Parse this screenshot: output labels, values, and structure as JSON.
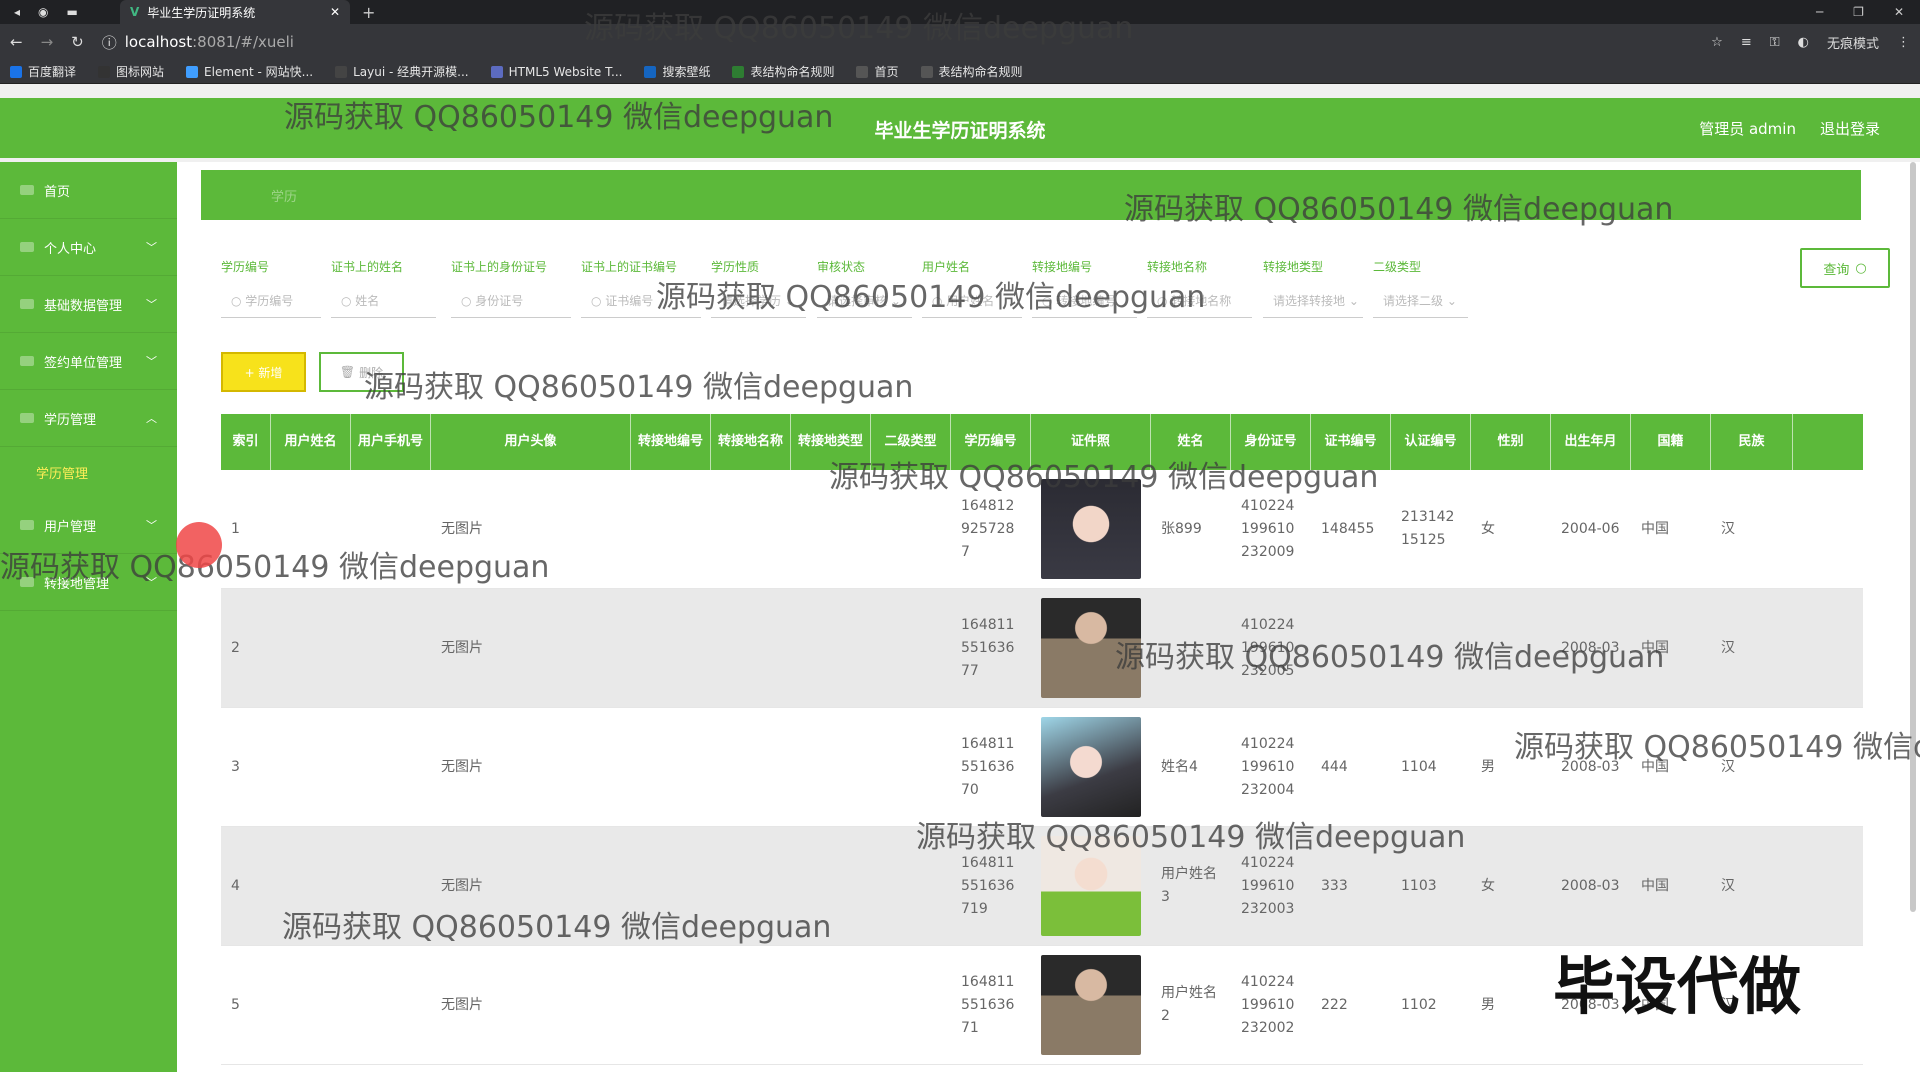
{
  "browser": {
    "tab_title": "毕业生学历证明系统",
    "url_host": "localhost",
    "url_path": ":8081/#/xueli",
    "profile": "无痕模式",
    "bookmarks": [
      "百度翻译",
      "图标网站",
      "Element - 网站快...",
      "Layui - 经典开源模...",
      "HTML5 Website T...",
      "搜索壁纸",
      "表结构命名规则",
      "首页",
      "表结构命名规则"
    ]
  },
  "header": {
    "title": "毕业生学历证明系统",
    "admin": "管理员 admin",
    "logout": "退出登录"
  },
  "sidebar": {
    "items": [
      {
        "label": "首页",
        "chevron": ""
      },
      {
        "label": "个人中心",
        "chevron": "﹀"
      },
      {
        "label": "基础数据管理",
        "chevron": "﹀"
      },
      {
        "label": "签约单位管理",
        "chevron": "﹀"
      },
      {
        "label": "学历管理",
        "chevron": "︿"
      }
    ],
    "sub": "学历管理",
    "items2": [
      {
        "label": "用户管理",
        "chevron": "﹀"
      },
      {
        "label": "转接地管理",
        "chevron": "﹀"
      }
    ]
  },
  "breadcrumb": "学历",
  "filters": {
    "labels": [
      "学历编号",
      "证书上的姓名",
      "证书上的身份证号",
      "证书上的证书编号",
      "学历性质",
      "审核状态",
      "用户姓名",
      "转接地编号",
      "转接地名称",
      "转接地类型",
      "二级类型"
    ],
    "placeholders": [
      "学历编号",
      "姓名",
      "身份证号",
      "证书编号",
      "请选择学历",
      "请选择审核",
      "用户姓名",
      "转接地编号",
      "转接地名称",
      "请选择转接地",
      "请选择二级"
    ],
    "search": "查询"
  },
  "actions": {
    "add": "+ 新增",
    "delete": "删除"
  },
  "table": {
    "headers": [
      "索引",
      "用户姓名",
      "用户手机号",
      "用户头像",
      "转接地编号",
      "转接地名称",
      "转接地类型",
      "二级类型",
      "学历编号",
      "证件照",
      "姓名",
      "身份证号",
      "证书编号",
      "认证编号",
      "性别",
      "出生年月",
      "国籍",
      "民族"
    ],
    "rows": [
      {
        "idx": "1",
        "avatar": "无图片",
        "code": "1648129257287",
        "name": "张899",
        "id": "410224199610232009",
        "cert": "148455",
        "auth": "21314215125",
        "sex": "女",
        "birth": "2004-06",
        "nation": "中国",
        "ethnic": "汉",
        "photo": "girl-a"
      },
      {
        "idx": "2",
        "avatar": "无图片",
        "code": "16481155163677",
        "name": "",
        "id": "410224199610232005",
        "cert": "",
        "auth": "",
        "sex": "",
        "birth": "2008-03",
        "nation": "中国",
        "ethnic": "汉",
        "photo": "boy"
      },
      {
        "idx": "3",
        "avatar": "无图片",
        "code": "16481155163670",
        "name": "姓名4",
        "id": "410224199610232004",
        "cert": "444",
        "auth": "1104",
        "sex": "男",
        "birth": "2008-03",
        "nation": "中国",
        "ethnic": "汉",
        "photo": "girl-b"
      },
      {
        "idx": "4",
        "avatar": "无图片",
        "code": "164811551636719",
        "name": "用户姓名3",
        "id": "410224199610232003",
        "cert": "333",
        "auth": "1103",
        "sex": "女",
        "birth": "2008-03",
        "nation": "中国",
        "ethnic": "汉",
        "photo": "girl-c"
      },
      {
        "idx": "5",
        "avatar": "无图片",
        "code": "16481155163671",
        "name": "用户姓名2",
        "id": "410224199610232002",
        "cert": "222",
        "auth": "1102",
        "sex": "男",
        "birth": "2008-03",
        "nation": "中国",
        "ethnic": "汉",
        "photo": "boy"
      }
    ]
  },
  "watermark": "源码获取 QQ86050149 微信deepguan",
  "watermark_cut": "源码获取 QQ86050149 微信d",
  "watermark_corner": "毕设代做"
}
